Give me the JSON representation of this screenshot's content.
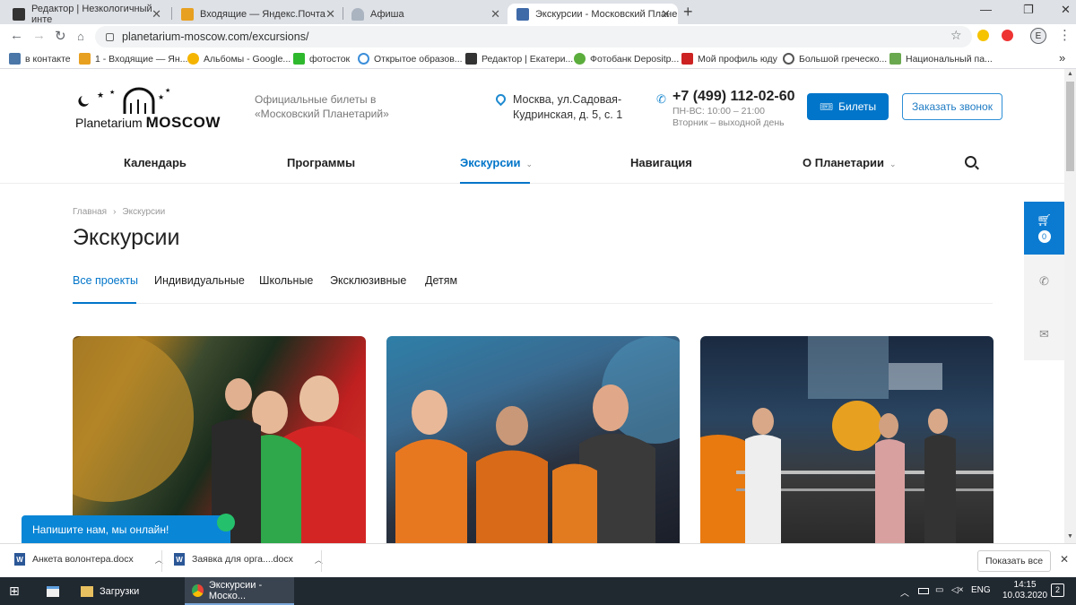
{
  "browser": {
    "tabs": [
      {
        "title": "Редактор | Незкологичный инте",
        "color": "#333333"
      },
      {
        "title": "Входящие — Яндекс.Почта",
        "color": "#e8a020"
      },
      {
        "title": "Афиша",
        "color": "#aab4c0"
      },
      {
        "title": "Экскурсии - Московский Плане",
        "color": "#3f6aa8"
      }
    ],
    "url": "planetarium-moscow.com/excursions/",
    "profile_initial": "E",
    "bookmarks": [
      {
        "label": "в контакте",
        "color": "#4a76a8"
      },
      {
        "label": "1 - Входящие — Ян...",
        "color": "#e8a020"
      },
      {
        "label": "Альбомы - Google...",
        "color": "#f4b400"
      },
      {
        "label": "фотосток",
        "color": "#2eb82e"
      },
      {
        "label": "Открытое образов...",
        "color": "#3b8ed9"
      },
      {
        "label": "Редактор | Екатери...",
        "color": "#333333"
      },
      {
        "label": "Фотобанк Depositp...",
        "color": "#5bad3c"
      },
      {
        "label": "Мой профиль юду",
        "color": "#cc2222"
      },
      {
        "label": "Большой греческо...",
        "color": "#555555"
      },
      {
        "label": "Национальный па...",
        "color": "#6aa84f"
      }
    ],
    "more_bookmarks": "»"
  },
  "site": {
    "logo_text_1": "Planetarium",
    "logo_text_2": "MOSCOW",
    "tagline": "Официальные билеты в «Московский Планетарий»",
    "address": "Москва, ул.Садовая-Кудринская, д. 5, с. 1",
    "phone": "+7 (499) 112-02-60",
    "hours_1": "ПН-ВС: 10:00 – 21:00",
    "hours_2": "Вторник – выходной день",
    "tickets_label": "Билеты",
    "callback_label": "Заказать звонок",
    "menu": [
      "Календарь",
      "Программы",
      "Экскурсии",
      "Навигация",
      "О Планетарии"
    ],
    "active_menu": "Экскурсии",
    "accent": "#0075c9"
  },
  "content": {
    "breadcrumb_home": "Главная",
    "breadcrumb_sep": "›",
    "breadcrumb_current": "Экскурсии",
    "title": "Экскурсии",
    "filters": [
      "Все проекты",
      "Индивидуальные",
      "Школьные",
      "Эксклюзивные",
      "Детям"
    ],
    "active_filter": "Все проекты",
    "cart_count": "0",
    "chat_label": "Напишите нам, мы онлайн!"
  },
  "downloads": {
    "items": [
      "Анкета волонтера.docx",
      "Заявка для орга....docx"
    ],
    "show_all": "Показать все"
  },
  "taskbar": {
    "items": [
      "Загрузки",
      "Экскурсии - Моско..."
    ],
    "lang": "ENG",
    "time": "14:15",
    "date": "10.03.2020",
    "notif_count": "2"
  }
}
